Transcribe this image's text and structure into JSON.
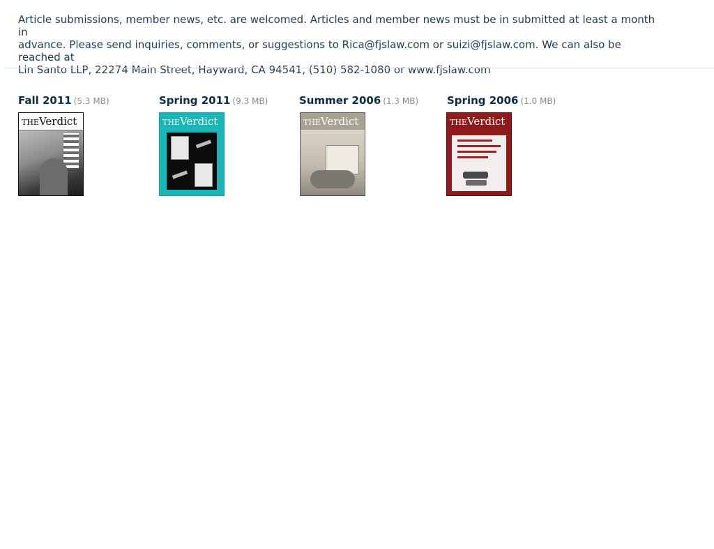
{
  "intro": {
    "text": "Article submissions, member news, etc. are welcomed.  Articles and member news must be in submitted at least a month in\nadvance.  Please send inquiries, comments, or suggestions to Rica@fjslaw.com or suizi@fjslaw.com.  We can also be reached at\nLin Santo LLP, 22274 Main Street, Hayward, CA 94541, (510) 582-1080 or www.fjslaw.com"
  },
  "issues": [
    {
      "title": "Fall 2011",
      "size": "(5.3 MB)",
      "masthead_the": "THE",
      "masthead_name": "Verdict"
    },
    {
      "title": "Spring 2011",
      "size": "(9.3 MB)",
      "masthead_the": "THE",
      "masthead_name": "Verdict"
    },
    {
      "title": "Summer 2006",
      "size": "(1.3 MB)",
      "masthead_the": "THE",
      "masthead_name": "Verdict"
    },
    {
      "title": "Spring 2006",
      "size": "(1.0 MB)",
      "masthead_the": "THE",
      "masthead_name": "Verdict"
    }
  ],
  "colors": {
    "text": "#1f3b52",
    "title": "#0c2c44",
    "size_text": "#8a8a8a",
    "divider": "#dcdcdc"
  }
}
